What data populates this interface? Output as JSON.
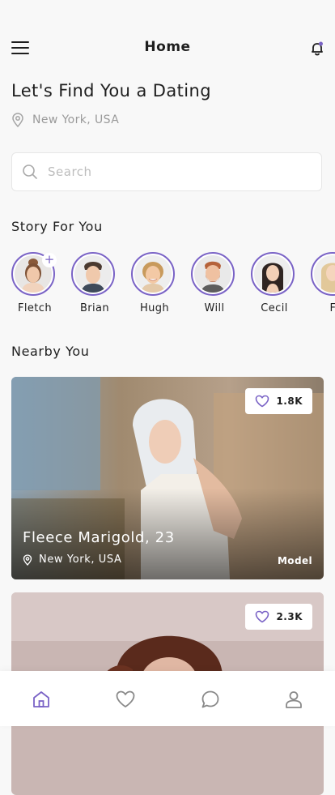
{
  "header": {
    "title": "Home"
  },
  "hero": {
    "headline": "Let's Find You a Dating",
    "location": "New York, USA"
  },
  "search": {
    "placeholder": "Search"
  },
  "stories": {
    "title": "Story For You",
    "items": [
      {
        "name": "Fletch"
      },
      {
        "name": "Brian"
      },
      {
        "name": "Hugh"
      },
      {
        "name": "Will"
      },
      {
        "name": "Cecil"
      },
      {
        "name": "Fi"
      }
    ]
  },
  "nearby": {
    "title": "Nearby You",
    "cards": [
      {
        "name_age": "Fleece Marigold, 23",
        "location": "New York, USA",
        "tag": "Model",
        "likes": "1.8K"
      },
      {
        "likes": "2.3K"
      }
    ]
  },
  "tabbar": {
    "items": [
      "home-icon",
      "heart-icon",
      "chat-icon",
      "profile-icon"
    ],
    "active_color": "#7a63c6",
    "inactive_color": "#8a8a8a"
  },
  "colors": {
    "accent": "#7a63c6",
    "notification_dot": "#7a63c6"
  }
}
